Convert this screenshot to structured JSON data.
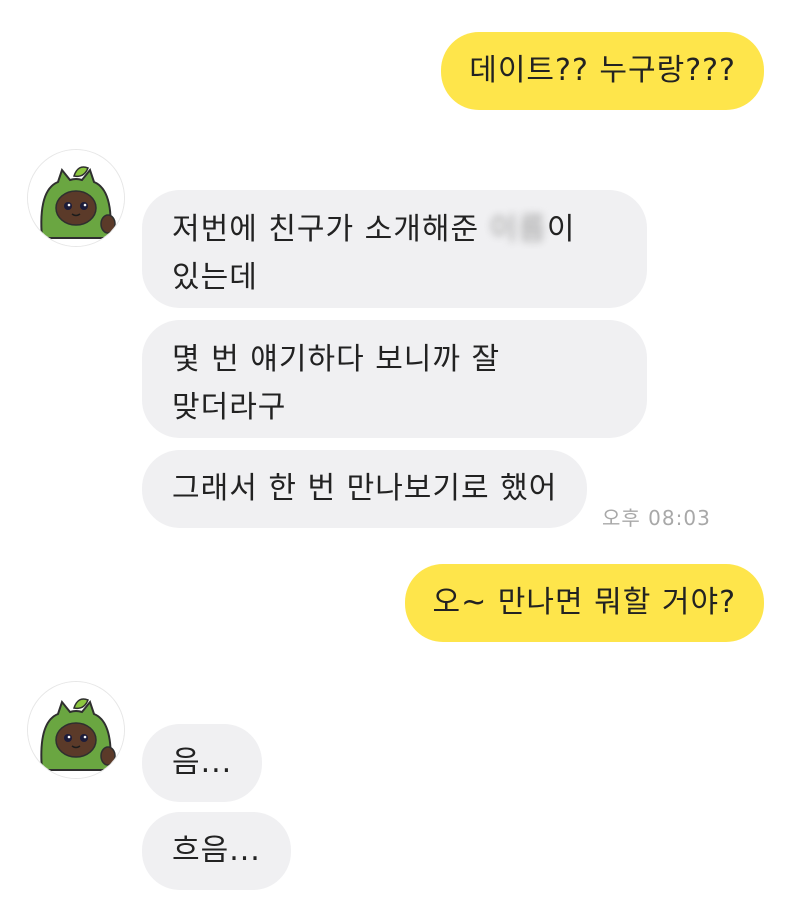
{
  "messages": [
    {
      "id": "m1",
      "sender": "me",
      "text": "데이트?? 누구랑???"
    },
    {
      "id": "m2",
      "sender": "them",
      "text_before": "저번에 친구가 소개해준 ",
      "text_blurred": "이름",
      "text_after": "이",
      "text_line2": "있는데"
    },
    {
      "id": "m3",
      "sender": "them",
      "text_line1": "몇 번 얘기하다 보니까 잘",
      "text_line2": "맞더라구"
    },
    {
      "id": "m4",
      "sender": "them",
      "text": "그래서 한 번 만나보기로 했어",
      "time": "오후 08:03"
    },
    {
      "id": "m5",
      "sender": "me",
      "text": "오~ 만나면 뭐할 거야?"
    },
    {
      "id": "m6",
      "sender": "them",
      "text": "음..."
    },
    {
      "id": "m7",
      "sender": "them",
      "text": "흐음..."
    }
  ],
  "avatar_icon": "cat-in-green-hood-avatar",
  "colors": {
    "my_bubble": "#fee54b",
    "their_bubble": "#f0f0f2",
    "text": "#222222",
    "timestamp": "#a8a8a8"
  }
}
